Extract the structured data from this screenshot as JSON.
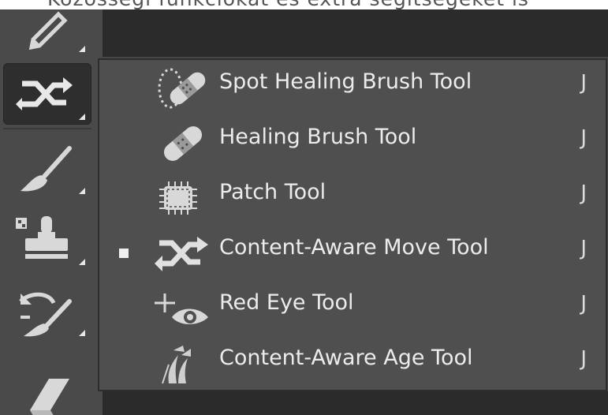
{
  "caption": "Közösségi funkciókat és extra segítségeket is",
  "toolbar": {
    "tools": [
      {
        "icon": "pencil-icon"
      },
      {
        "icon": "content-aware-move-icon",
        "selected": true
      },
      {
        "icon": "brush-icon"
      },
      {
        "icon": "clone-stamp-icon"
      },
      {
        "icon": "history-brush-icon"
      },
      {
        "icon": "eraser-icon"
      }
    ]
  },
  "menu": {
    "items": [
      {
        "label": "Spot Healing Brush Tool",
        "shortcut": "J",
        "icon": "spot-healing-brush-icon",
        "active": false
      },
      {
        "label": "Healing Brush Tool",
        "shortcut": "J",
        "icon": "healing-brush-icon",
        "active": false
      },
      {
        "label": "Patch Tool",
        "shortcut": "J",
        "icon": "patch-icon",
        "active": false
      },
      {
        "label": "Content-Aware Move Tool",
        "shortcut": "J",
        "icon": "content-aware-move-icon",
        "active": true
      },
      {
        "label": "Red Eye Tool",
        "shortcut": "J",
        "icon": "red-eye-icon",
        "active": false
      },
      {
        "label": "Content-Aware Age Tool",
        "shortcut": "J",
        "icon": "content-aware-age-icon",
        "active": false
      }
    ]
  }
}
